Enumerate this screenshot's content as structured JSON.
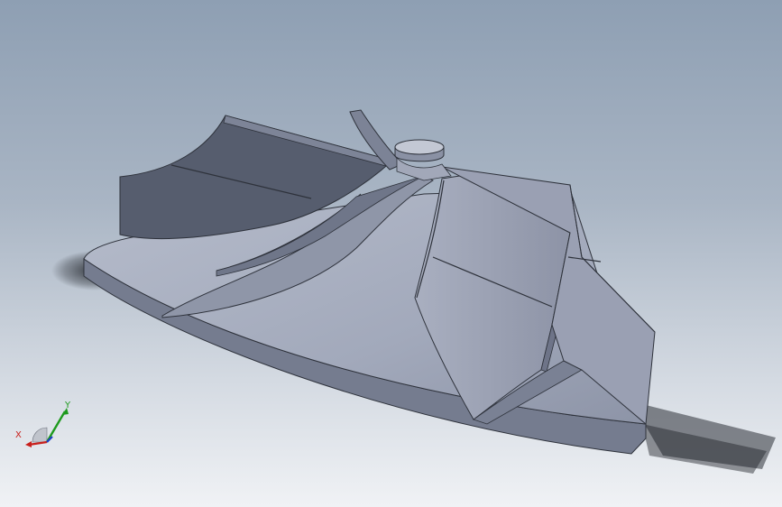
{
  "viewport": {
    "background_top": "#8e9fb3",
    "background_bottom": "#f0f2f5",
    "model": "impeller-icon"
  },
  "triad": {
    "x_label": "X",
    "y_label": "Y",
    "x_color": "#c8201c",
    "y_color": "#1e9a1e",
    "z_color": "#1c3cc8"
  }
}
